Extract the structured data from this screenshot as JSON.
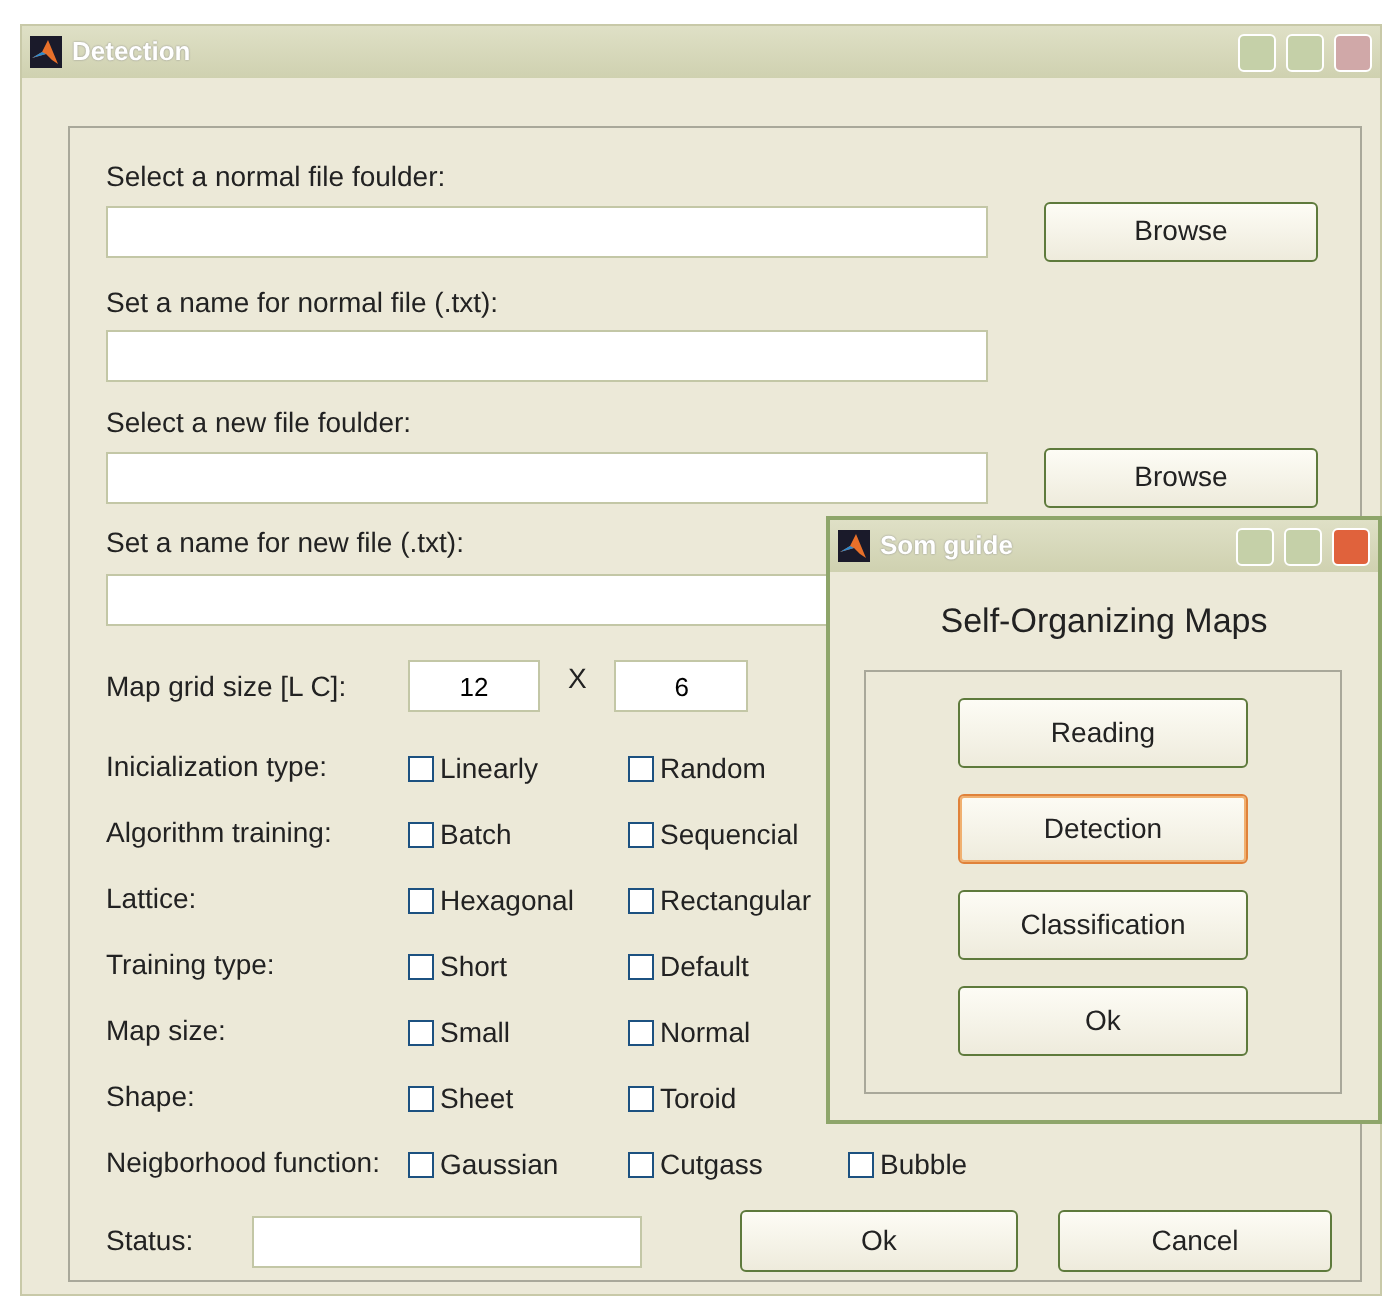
{
  "window": {
    "title": "Detection"
  },
  "file_fields": [
    {
      "kind": "folder",
      "label": "Select a normal file foulder:",
      "button": "Browse"
    },
    {
      "kind": "name",
      "label": "Set a name for normal file (.txt):"
    },
    {
      "kind": "folder",
      "label": "Select a new file foulder:",
      "button": "Browse"
    },
    {
      "kind": "name",
      "label": "Set a name for new file (.txt):"
    }
  ],
  "grid_size": {
    "label": "Map grid size [L C]:",
    "rows": "12",
    "separator": "X",
    "columns": "6"
  },
  "options": [
    {
      "label": "Inicialization type:",
      "choices": [
        {
          "label": "Linearly",
          "checked": false
        },
        {
          "label": "Random",
          "checked": false
        }
      ]
    },
    {
      "label": "Algorithm training:",
      "choices": [
        {
          "label": "Batch",
          "checked": false
        },
        {
          "label": "Sequencial",
          "checked": false
        }
      ]
    },
    {
      "label": "Lattice:",
      "choices": [
        {
          "label": "Hexagonal",
          "checked": false
        },
        {
          "label": "Rectangular",
          "checked": false
        }
      ]
    },
    {
      "label": "Training type:",
      "choices": [
        {
          "label": "Short",
          "checked": false
        },
        {
          "label": "Default",
          "checked": false
        }
      ]
    },
    {
      "label": "Map size:",
      "choices": [
        {
          "label": "Small",
          "checked": false
        },
        {
          "label": "Normal",
          "checked": false
        }
      ]
    },
    {
      "label": "Shape:",
      "choices": [
        {
          "label": "Sheet",
          "checked": false
        },
        {
          "label": "Toroid",
          "checked": false
        }
      ]
    },
    {
      "label": "Neigborhood function:",
      "choices": [
        {
          "label": "Gaussian",
          "checked": false
        },
        {
          "label": "Cutgass",
          "checked": false
        },
        {
          "label": "Bubble",
          "checked": false
        }
      ]
    }
  ],
  "status": {
    "label": "Status:"
  },
  "buttons": [
    {
      "label": "Ok"
    },
    {
      "label": "Cancel"
    }
  ],
  "dialog": {
    "title": "Som guide",
    "heading": "Self-Organizing Maps",
    "buttons": [
      {
        "label": "Reading",
        "focused": false
      },
      {
        "label": "Detection",
        "focused": true
      },
      {
        "label": "Classification",
        "focused": false
      },
      {
        "label": "Ok",
        "focused": false
      }
    ]
  }
}
